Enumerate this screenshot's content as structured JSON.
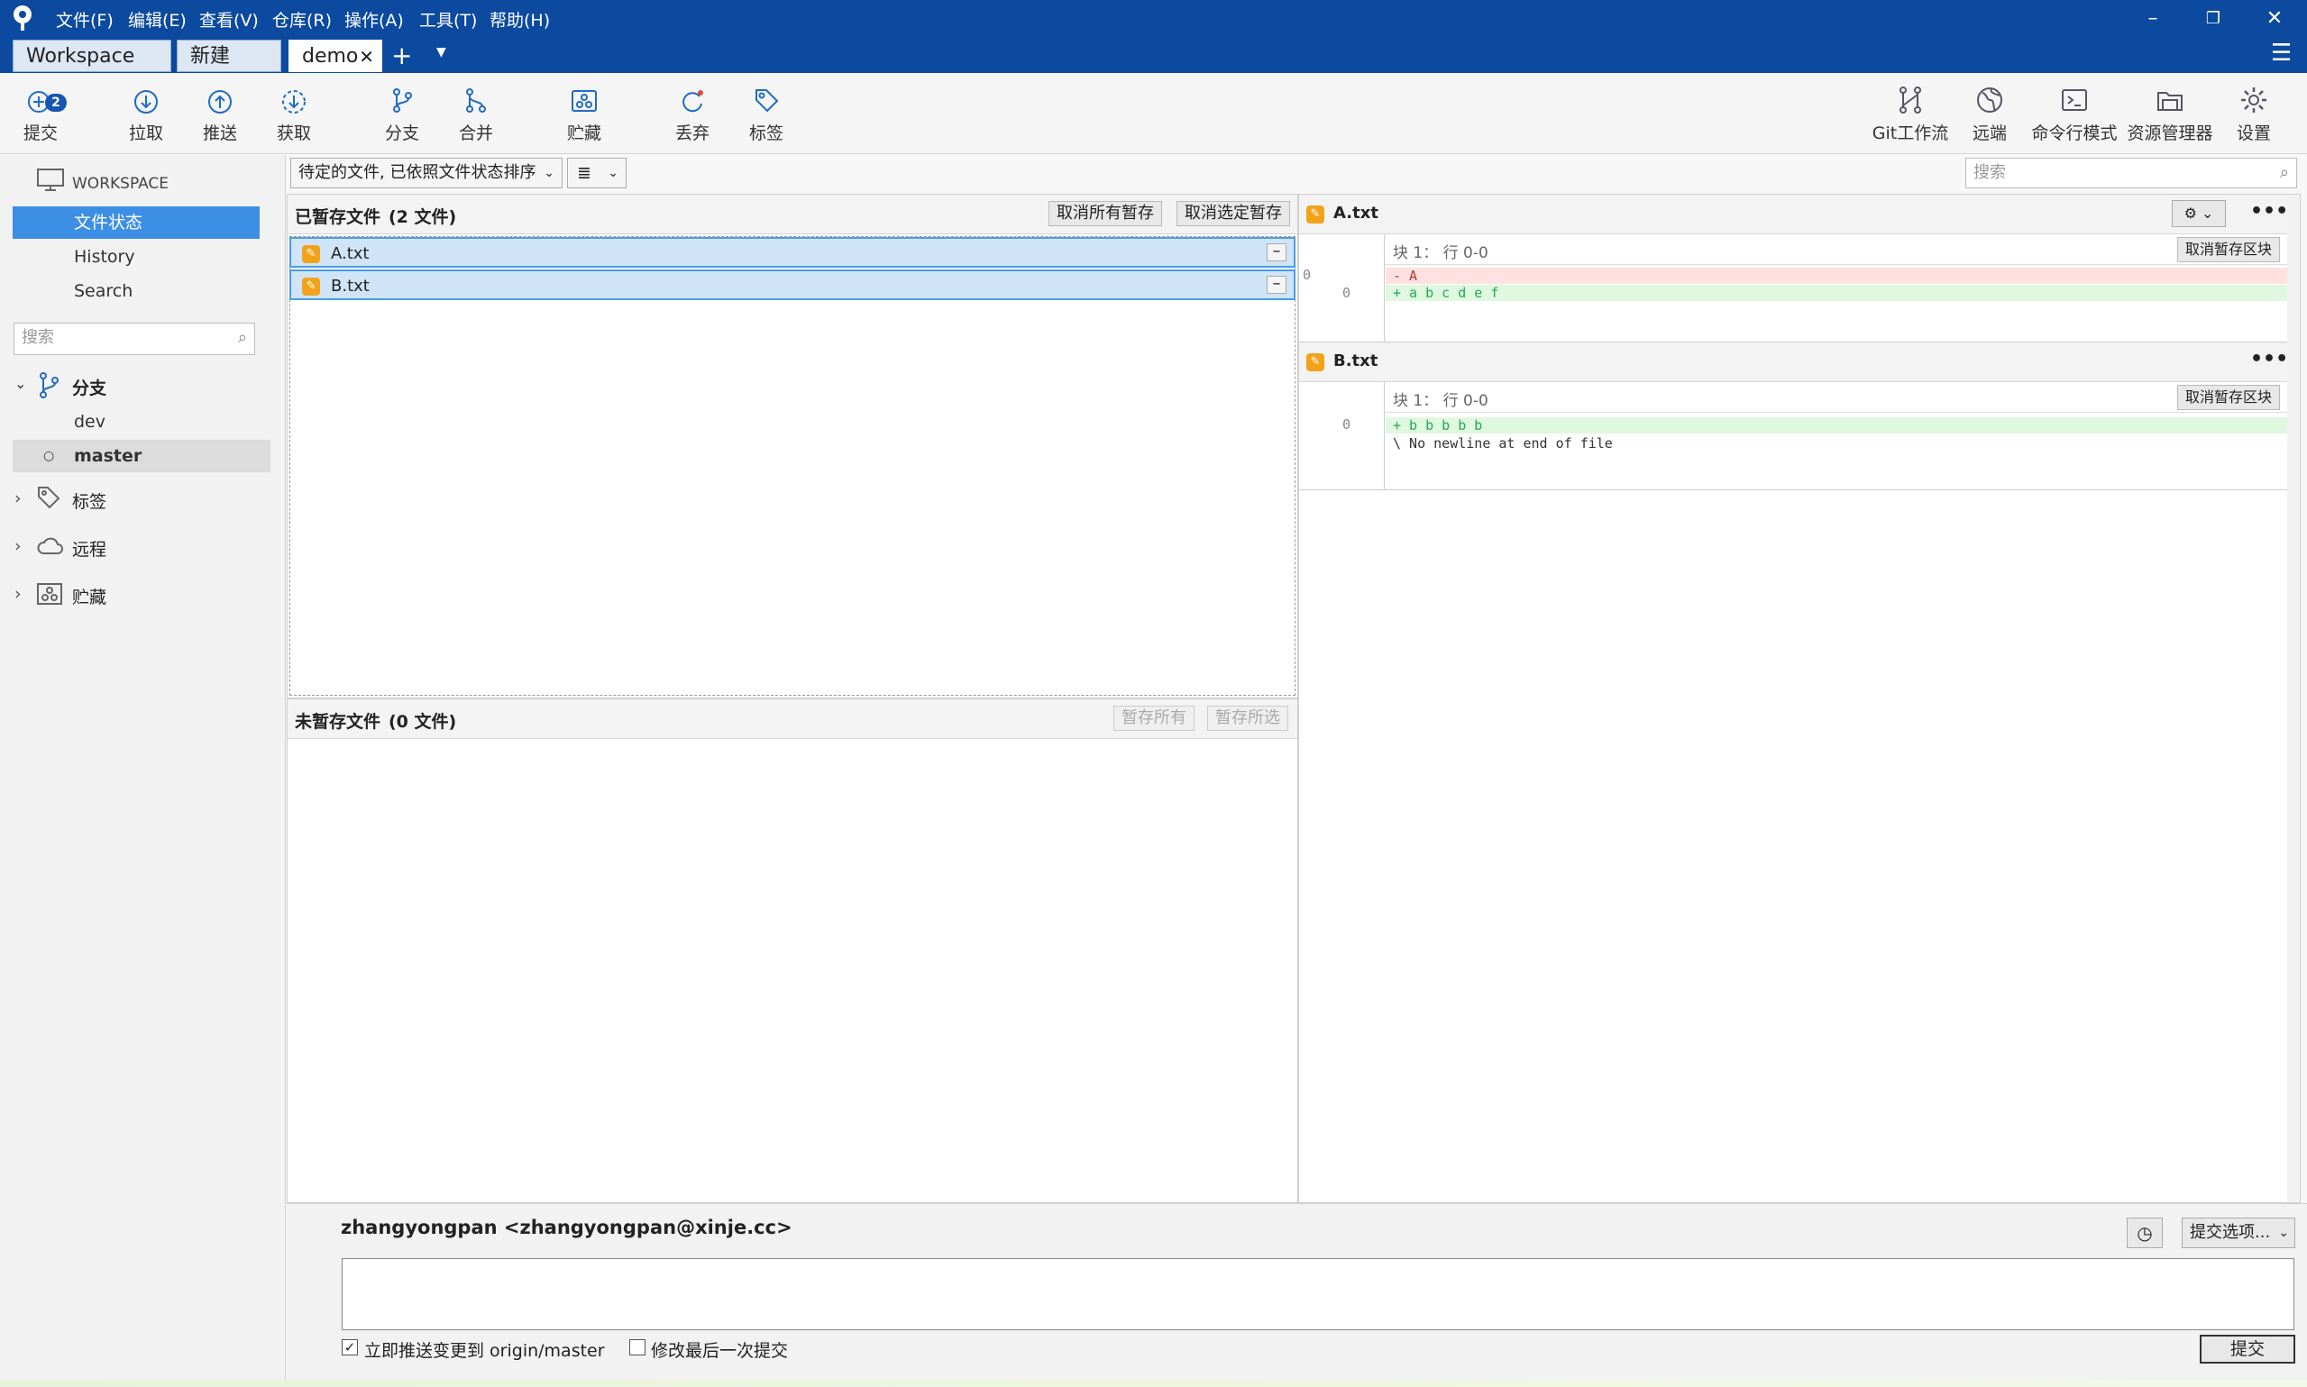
{
  "window": {
    "menu": [
      "文件(F)",
      "编辑(E)",
      "查看(V)",
      "仓库(R)",
      "操作(A)",
      "工具(T)",
      "帮助(H)"
    ],
    "tabs": [
      "Workspace",
      "新建文...",
      "demo"
    ],
    "controls": {
      "minimize": "–",
      "restore": "❐",
      "close": "✕",
      "menu": "☰"
    }
  },
  "toolbar": {
    "commit": "提交",
    "commit_badge": "2",
    "pull": "拉取",
    "push": "推送",
    "fetch": "获取",
    "branch": "分支",
    "merge": "合并",
    "stash": "贮藏",
    "discard": "丢弃",
    "tag": "标签",
    "gitflow": "Git工作流",
    "remote": "远端",
    "terminal": "命令行模式",
    "explorer": "资源管理器",
    "settings": "设置"
  },
  "sidebar": {
    "workspace": "WORKSPACE",
    "items": [
      "文件状态",
      "History",
      "Search"
    ],
    "search_placeholder": "搜索",
    "branches_label": "分支",
    "branches": [
      "dev",
      "master"
    ],
    "tags_label": "标签",
    "remotes_label": "远程",
    "stashes_label": "贮藏"
  },
  "filter": {
    "sort_select": "待定的文件, 已依照文件状态排序",
    "view_toggle": "≣",
    "search_placeholder": "搜索"
  },
  "staged": {
    "title": "已暂存文件",
    "count": "(2 文件)",
    "unstage_all": "取消所有暂存",
    "unstage_selected": "取消选定暂存",
    "files": [
      "A.txt",
      "B.txt"
    ]
  },
  "unstaged": {
    "title": "未暂存文件",
    "count": "(0 文件)",
    "stage_all": "暂存所有",
    "stage_selected": "暂存所选"
  },
  "diffs": [
    {
      "file": "A.txt",
      "hunk": "块 1： 行 0-0",
      "hunk_button": "取消暂存区块",
      "lines": [
        {
          "old": "0",
          "new": "",
          "text": "- A",
          "type": "del"
        },
        {
          "old": "",
          "new": "0",
          "text": "+ a b c d e f",
          "type": "add"
        }
      ]
    },
    {
      "file": "B.txt",
      "hunk": "块 1： 行 0-0",
      "hunk_button": "取消暂存区块",
      "lines": [
        {
          "old": "",
          "new": "0",
          "text": "+ b b b b b",
          "type": "add"
        },
        {
          "old": "",
          "new": "",
          "text": "\\  No newline at end of file",
          "type": "ctx"
        }
      ]
    }
  ],
  "commit": {
    "author": "zhangyongpan <zhangyongpan@xinje.cc>",
    "options": "提交选项...",
    "push_checkbox": "立即推送变更到 origin/master",
    "amend_checkbox": "修改最后一次提交",
    "submit": "提交"
  },
  "colors": {
    "titlebar": "#0b4a9e",
    "selection": "#3d8fe6",
    "file_icon": "#f2a31b"
  }
}
